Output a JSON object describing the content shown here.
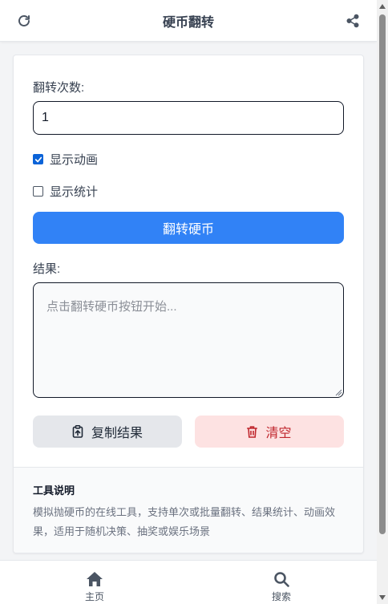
{
  "header": {
    "title": "硬币翻转",
    "refresh_icon": "refresh-icon",
    "share_icon": "share-icon"
  },
  "form": {
    "count_label": "翻转次数:",
    "count_value": "1",
    "animation_label": "显示动画",
    "animation_checked": true,
    "stats_label": "显示统计",
    "stats_checked": false,
    "flip_button": "翻转硬币",
    "result_label": "结果:",
    "result_placeholder": "点击翻转硬币按钮开始...",
    "result_value": "",
    "copy_button": "复制结果",
    "clear_button": "清空"
  },
  "info": {
    "title": "工具说明",
    "text": "模拟抛硬币的在线工具，支持单次或批量翻转、结果统计、动画效果，适用于随机决策、抽奖或娱乐场景"
  },
  "nav": {
    "home_label": "主页",
    "search_label": "搜索"
  },
  "colors": {
    "primary": "#3182f6",
    "danger_bg": "#fde2e2",
    "danger_text": "#c0262d",
    "checkbox": "#0b63d8"
  }
}
